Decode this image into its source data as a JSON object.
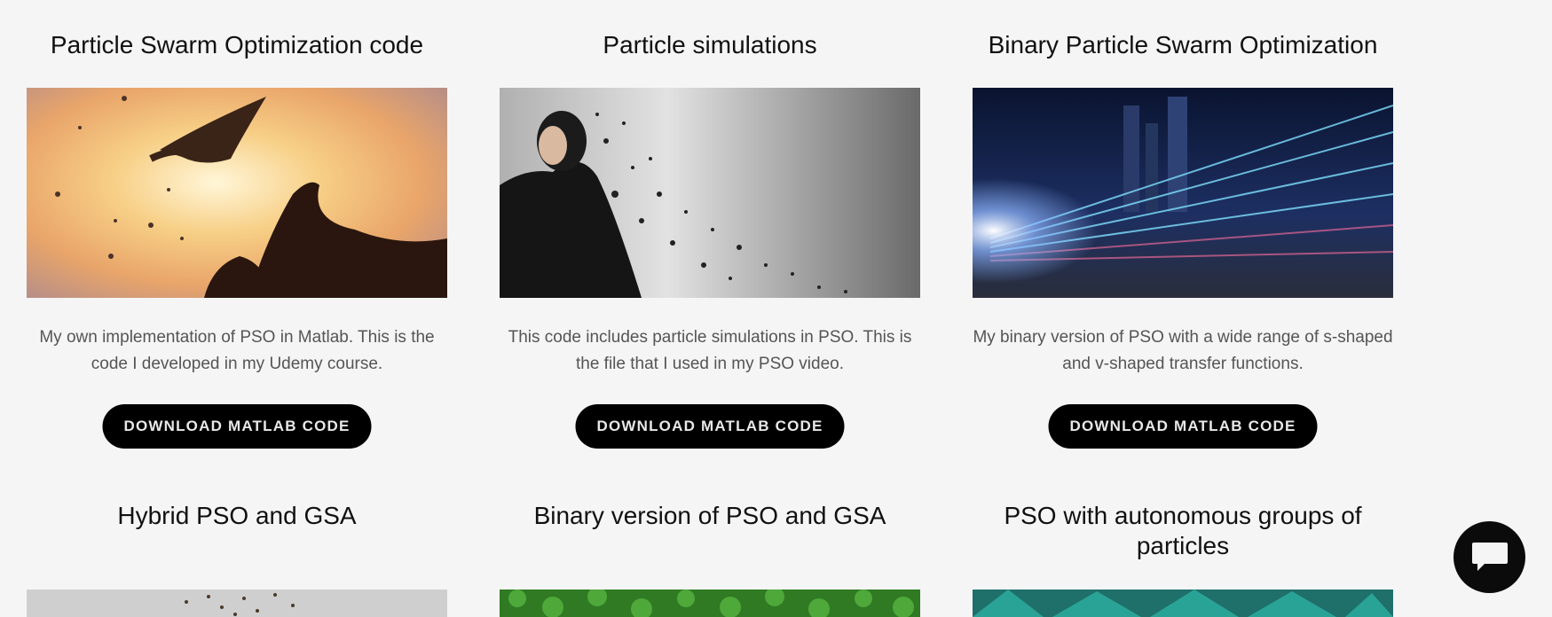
{
  "cards": [
    {
      "title": "Particle Swarm Optimization code",
      "description": "My own implementation of PSO in Matlab. This is the code I developed in my  Udemy course.",
      "button_label": "DOWNLOAD MATLAB CODE",
      "image": "bird-hands-sunset"
    },
    {
      "title": "Particle simulations",
      "description": "This code includes particle simulations in PSO. This is the file that I used in my PSO video.",
      "button_label": "DOWNLOAD MATLAB CODE",
      "image": "man-disintegrating-particles"
    },
    {
      "title": "Binary Particle Swarm Optimization",
      "description": "My binary version of PSO with a wide range of s-shaped and v-shaped transfer functions.",
      "button_label": "DOWNLOAD MATLAB CODE",
      "image": "city-binary-light-trails"
    },
    {
      "title": "Hybrid PSO and GSA",
      "image": "birds-flock-sky"
    },
    {
      "title": "Binary version of PSO and GSA",
      "image": "green-forest-aerial"
    },
    {
      "title": "PSO with autonomous groups of particles",
      "image": "teal-umbrellas"
    }
  ],
  "chat": {
    "icon": "chat-bubble-icon"
  },
  "colors": {
    "background": "#f5f5f5",
    "button": "#000000",
    "button_text": "#e8e8e8"
  }
}
